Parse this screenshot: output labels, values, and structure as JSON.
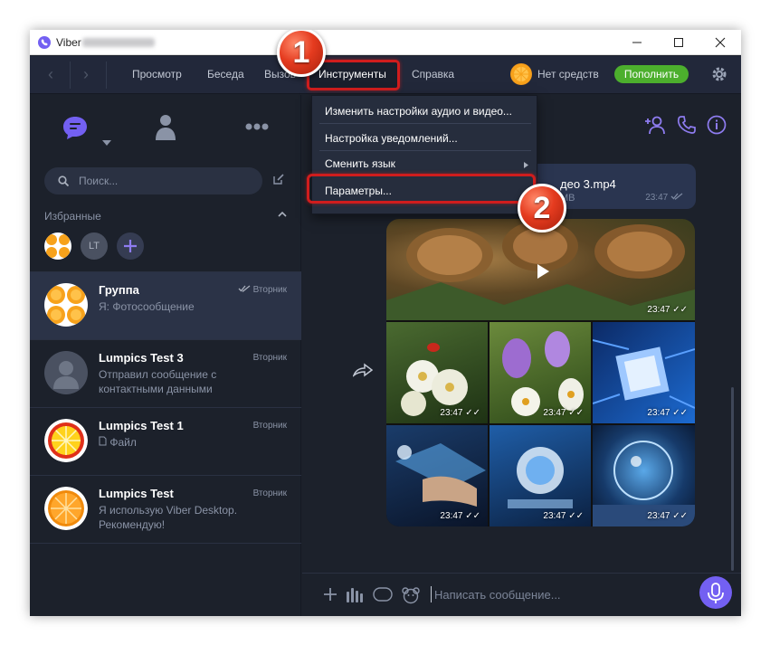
{
  "window": {
    "title": "Viber"
  },
  "menubar": {
    "items": [
      "Просмотр",
      "Беседа",
      "Вызов",
      "Инструменты",
      "Справка"
    ],
    "active_item": "Инструменты",
    "balance": "Нет средств",
    "topup_label": "Пополнить"
  },
  "dropdown": {
    "items": [
      "Изменить настройки аудио и видео...",
      "Настройка уведомлений...",
      "Сменить язык",
      "Параметры..."
    ]
  },
  "sidebar": {
    "search_placeholder": "Поиск...",
    "favorites_label": "Избранные",
    "favorites": [
      {
        "initials": "LT"
      }
    ],
    "chats": [
      {
        "name": "Группа",
        "time": "Вторник",
        "message": "Я: Фотосообщение"
      },
      {
        "name": "Lumpics Test 3",
        "time": "Вторник",
        "message": "Отправил сообщение с контактными данными"
      },
      {
        "name": "Lumpics Test 1",
        "time": "Вторник",
        "message": "Файл"
      },
      {
        "name": "Lumpics Test",
        "time": "Вторник",
        "message": "Я использую Viber Desktop. Рекомендую!"
      }
    ]
  },
  "conversation": {
    "file": {
      "name": "део 3.mp4",
      "size": "MB",
      "time": "23:47"
    },
    "media_times": [
      "23:47",
      "23:47",
      "23:47",
      "23:47",
      "23:47",
      "23:47",
      "23:47"
    ]
  },
  "composer": {
    "placeholder": "Написать сообщение..."
  },
  "annotations": {
    "step1": "1",
    "step2": "2"
  },
  "colors": {
    "accent": "#7360f2",
    "topup": "#4caf2d",
    "highlight": "#d01d1d"
  }
}
